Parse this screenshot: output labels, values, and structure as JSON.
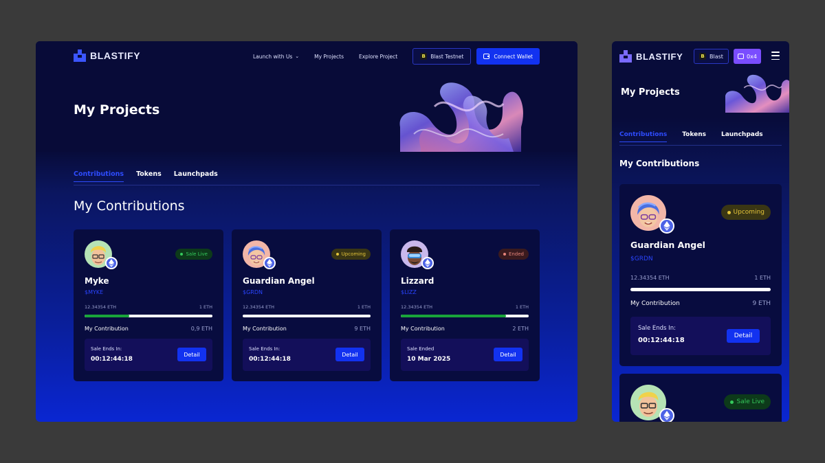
{
  "brand": {
    "name": "BLASTIFY"
  },
  "colors": {
    "accent": "#1232f0",
    "live": "#35c95c",
    "upcoming": "#e5c53a",
    "ended": "#e6847a",
    "wallet_mobile": "#7a4dff"
  },
  "desktop": {
    "nav": {
      "launch": "Launch with Us",
      "projects": "My Projects",
      "explore": "Explore Project"
    },
    "network_button": "Blast Testnet",
    "wallet_button": "Connect Wallet",
    "page_title": "My Projects",
    "tabs": [
      "Contributions",
      "Tokens",
      "Launchpads"
    ],
    "section_title": "My Contributions",
    "cards": [
      {
        "name": "Myke",
        "ticker": "$MYKE",
        "status": "Sale Live",
        "raised": "12.34354 ETH",
        "cap": "1 ETH",
        "progress": 0.35,
        "contribution_label": "My Contribution",
        "contribution": "0,9 ETH",
        "sale_label": "Sale Ends In:",
        "sale_value": "00:12:44:18",
        "button": "Detail",
        "avatar": "blond-glasses-avatar"
      },
      {
        "name": "Guardian Angel",
        "ticker": "$GRDN",
        "status": "Upcoming",
        "raised": "12.34354 ETH",
        "cap": "1 ETH",
        "progress": 0.0,
        "contribution_label": "My Contribution",
        "contribution": "9 ETH",
        "sale_label": "Sale Ends In:",
        "sale_value": "00:12:44:18",
        "button": "Detail",
        "avatar": "blue-hair-avatar"
      },
      {
        "name": "Lizzard",
        "ticker": "$LIZZ",
        "status": "Ended",
        "raised": "12.34354 ETH",
        "cap": "1 ETH",
        "progress": 0.82,
        "contribution_label": "My Contribution",
        "contribution": "2 ETH",
        "sale_label": "Sale Ended",
        "sale_value": "10 Mar 2025",
        "button": "Detail",
        "avatar": "vr-goggles-avatar"
      }
    ]
  },
  "mobile": {
    "network_button": "Blast",
    "wallet_button": "0x4",
    "page_title": "My Projects",
    "tabs": [
      "Contributions",
      "Tokens",
      "Launchpads"
    ],
    "section_title": "My Contributions",
    "card": {
      "name": "Guardian Angel",
      "ticker": "$GRDN",
      "status": "Upcoming",
      "raised": "12.34354 ETH",
      "cap": "1 ETH",
      "contribution_label": "My Contribution",
      "contribution": "9 ETH",
      "sale_label": "Sale Ends In:",
      "sale_value": "00:12:44:18",
      "button": "Detail"
    },
    "card_partial": {
      "status": "Sale Live"
    }
  }
}
